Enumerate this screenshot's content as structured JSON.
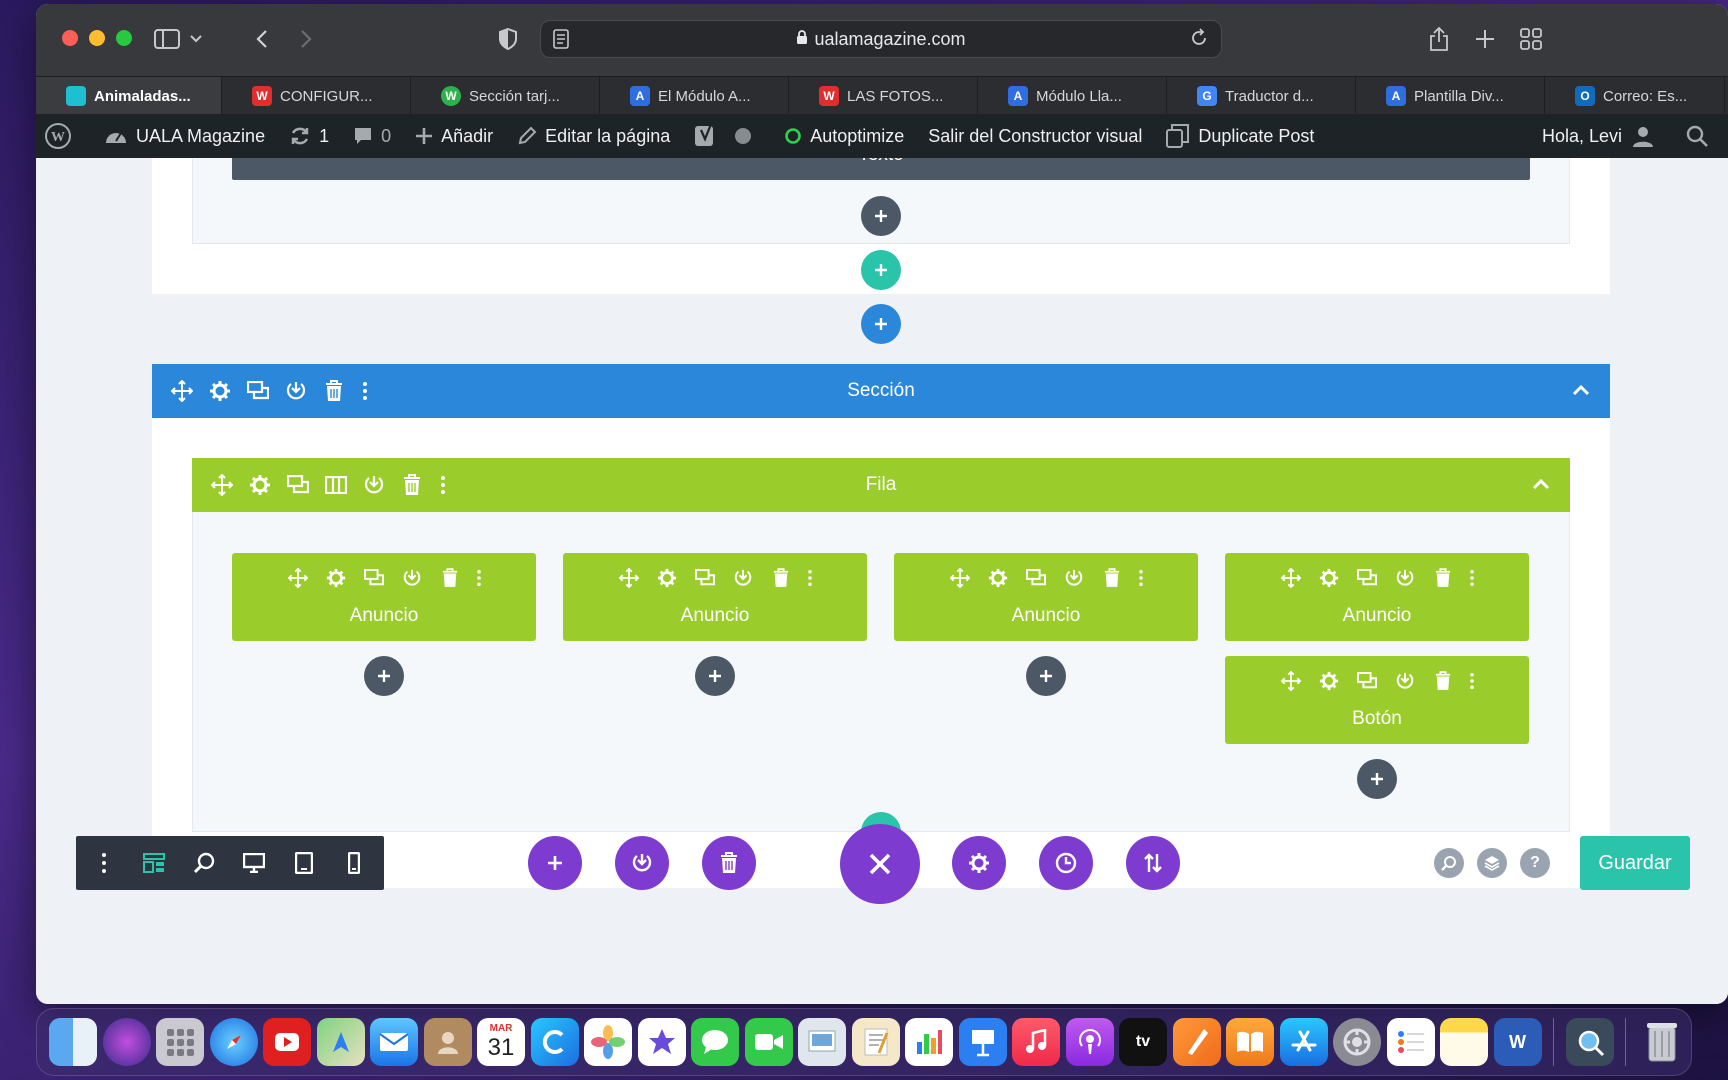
{
  "browser": {
    "url": "ualamagazine.com",
    "tabs": [
      {
        "label": "Animaladas...",
        "color": "#1ebfd1"
      },
      {
        "label": "CONFIGUR...",
        "color": "#e02e2e"
      },
      {
        "label": "Sección tarj...",
        "color": "#2bb24c"
      },
      {
        "label": "El Módulo A...",
        "color": "#2f6ee0"
      },
      {
        "label": "LAS FOTOS...",
        "color": "#e02e2e"
      },
      {
        "label": "Módulo Lla...",
        "color": "#2f6ee0"
      },
      {
        "label": "Traductor d...",
        "color": "#4285f4"
      },
      {
        "label": "Plantilla Div...",
        "color": "#2f6ee0"
      },
      {
        "label": "Correo: Es...",
        "color": "#0f6cbd"
      }
    ]
  },
  "adminbar": {
    "site": "UALA Magazine",
    "updates": "1",
    "comments": "0",
    "add": "Añadir",
    "edit": "Editar la página",
    "autoptimize": "Autoptimize",
    "exit_builder": "Salir del Constructor visual",
    "duplicate": "Duplicate Post",
    "greeting": "Hola, Levi"
  },
  "builder": {
    "top_module_label": "Texto",
    "section_label": "Sección",
    "row_label": "Fila",
    "modules": [
      {
        "label": "Anuncio"
      },
      {
        "label": "Anuncio"
      },
      {
        "label": "Anuncio"
      },
      {
        "label": "Anuncio"
      },
      {
        "label": "Botón"
      }
    ],
    "save_label": "Guardar"
  },
  "colors": {
    "section": "#2b87da",
    "row": "#9acd2c",
    "module": "#9acd2c",
    "accent_purple": "#7e3bd0",
    "accent_teal": "#29c4a9"
  },
  "dock": {
    "calendar_month": "MAR",
    "calendar_day": "31",
    "tv_label": "tv"
  }
}
